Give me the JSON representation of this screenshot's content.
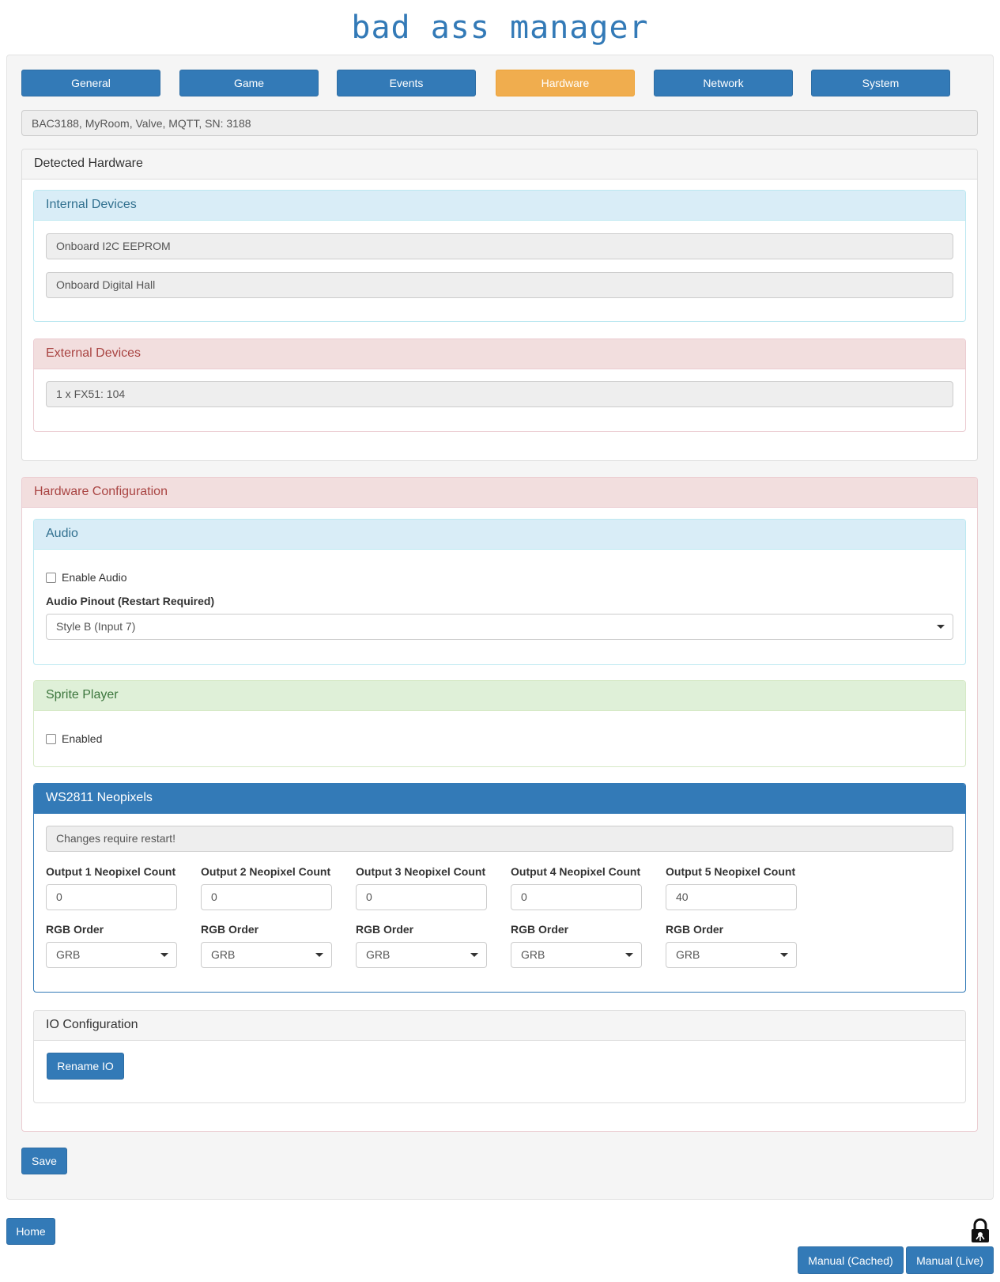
{
  "app": {
    "title": "bad ass manager"
  },
  "tabs": [
    {
      "label": "General"
    },
    {
      "label": "Game"
    },
    {
      "label": "Events"
    },
    {
      "label": "Hardware",
      "active": true
    },
    {
      "label": "Network"
    },
    {
      "label": "System"
    }
  ],
  "device_info": "BAC3188, MyRoom, Valve, MQTT, SN: 3188",
  "detected_hardware": {
    "title": "Detected Hardware",
    "internal": {
      "title": "Internal Devices",
      "items": [
        "Onboard I2C EEPROM",
        "Onboard Digital Hall"
      ]
    },
    "external": {
      "title": "External Devices",
      "items": [
        "1 x FX51: 104"
      ]
    }
  },
  "hardware_config": {
    "title": "Hardware Configuration",
    "audio": {
      "title": "Audio",
      "enable_label": "Enable Audio",
      "enabled": false,
      "pinout_label": "Audio Pinout (Restart Required)",
      "pinout_value": "Style B (Input 7)"
    },
    "sprite": {
      "title": "Sprite Player",
      "enabled_label": "Enabled",
      "enabled": false
    },
    "neopixels": {
      "title": "WS2811 Neopixels",
      "notice": "Changes require restart!",
      "outputs": [
        {
          "count_label": "Output 1 Neopixel Count",
          "count": "0",
          "order_label": "RGB Order",
          "order": "GRB"
        },
        {
          "count_label": "Output 2 Neopixel Count",
          "count": "0",
          "order_label": "RGB Order",
          "order": "GRB"
        },
        {
          "count_label": "Output 3 Neopixel Count",
          "count": "0",
          "order_label": "RGB Order",
          "order": "GRB"
        },
        {
          "count_label": "Output 4 Neopixel Count",
          "count": "0",
          "order_label": "RGB Order",
          "order": "GRB"
        },
        {
          "count_label": "Output 5 Neopixel Count",
          "count": "40",
          "order_label": "RGB Order",
          "order": "GRB"
        }
      ]
    },
    "io": {
      "title": "IO Configuration",
      "rename_label": "Rename IO"
    }
  },
  "save_label": "Save",
  "footer": {
    "home_label": "Home",
    "manual_cached_label": "Manual (Cached)",
    "manual_live_label": "Manual (Live)",
    "lock_icon": "lock-icon"
  },
  "colors": {
    "primary": "#337ab7",
    "active_tab": "#f0ad4e",
    "info_heading": "#d9edf7",
    "danger_heading": "#f2dede",
    "success_heading": "#dff0d8"
  }
}
